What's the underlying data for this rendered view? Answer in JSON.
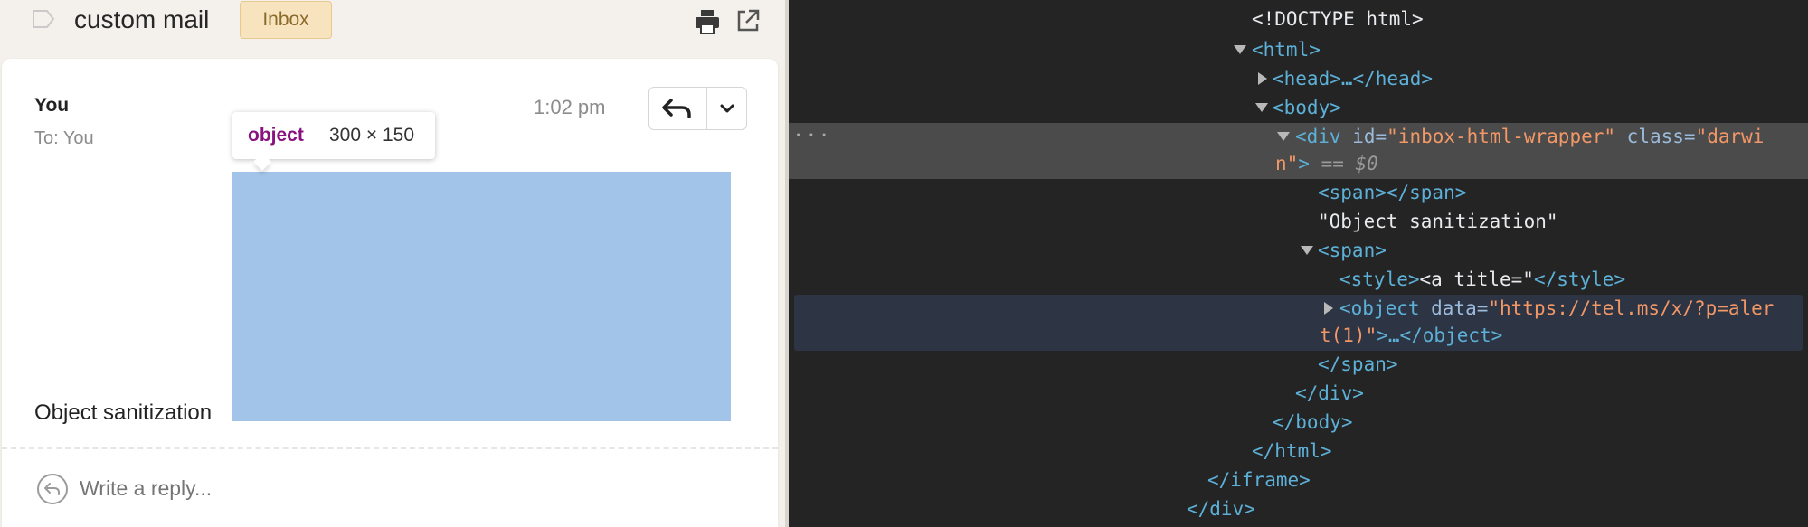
{
  "mail": {
    "subject": "custom mail",
    "label_badge": "Inbox",
    "icons": {
      "label": "label-outline-icon",
      "print": "print-icon",
      "popout": "popout-icon",
      "reply": "reply-icon",
      "menu": "chevron-down-icon",
      "reply_circle": "reply-circle-icon"
    },
    "message": {
      "sender": "You",
      "recipient": "To: You",
      "time": "1:02 pm",
      "body_text": "Object sanitization"
    },
    "inspector_tooltip": {
      "tag": "object",
      "size": "300 × 150"
    },
    "reply_placeholder": "Write a reply..."
  },
  "devtools": {
    "lines": {
      "doctype": "<!DOCTYPE html>",
      "html_open": "<html>",
      "head": "<head>…</head>",
      "body_open": "<body>",
      "div_open_tag": "<div",
      "div_id_attr": " id=",
      "div_id_val": "\"inbox-html-wrapper\"",
      "div_class_attr": " class=",
      "div_class_val_1": "\"darwi",
      "div_class_val_2": "n\"",
      "div_close_bracket": ">",
      "div_selected_marker": " == $0",
      "span_empty": "<span></span>",
      "text_node": "\"Object sanitization\"",
      "span_open": "<span>",
      "style_open": "<style>",
      "style_content": "<a title=\"",
      "style_close": "</style>",
      "object_open": "<object",
      "object_data_attr": " data=",
      "object_data_val_1": "\"https://tel.ms/x/?p=aler",
      "object_data_val_2": "t(1)\"",
      "object_close_part": ">…</object>",
      "span_close": "</span>",
      "div_close": "</div>",
      "body_close": "</body>",
      "html_close": "</html>",
      "iframe_close": "</iframe>",
      "outer_div_close": "</div>"
    },
    "ellipsis": "···"
  },
  "colors": {
    "highlight": "#a1c4e8",
    "devtools_bg": "#242424",
    "tag": "#5db0d7",
    "attr_value": "#f29766",
    "tooltip_tag": "#881280",
    "badge_bg": "#f7e4bf"
  }
}
